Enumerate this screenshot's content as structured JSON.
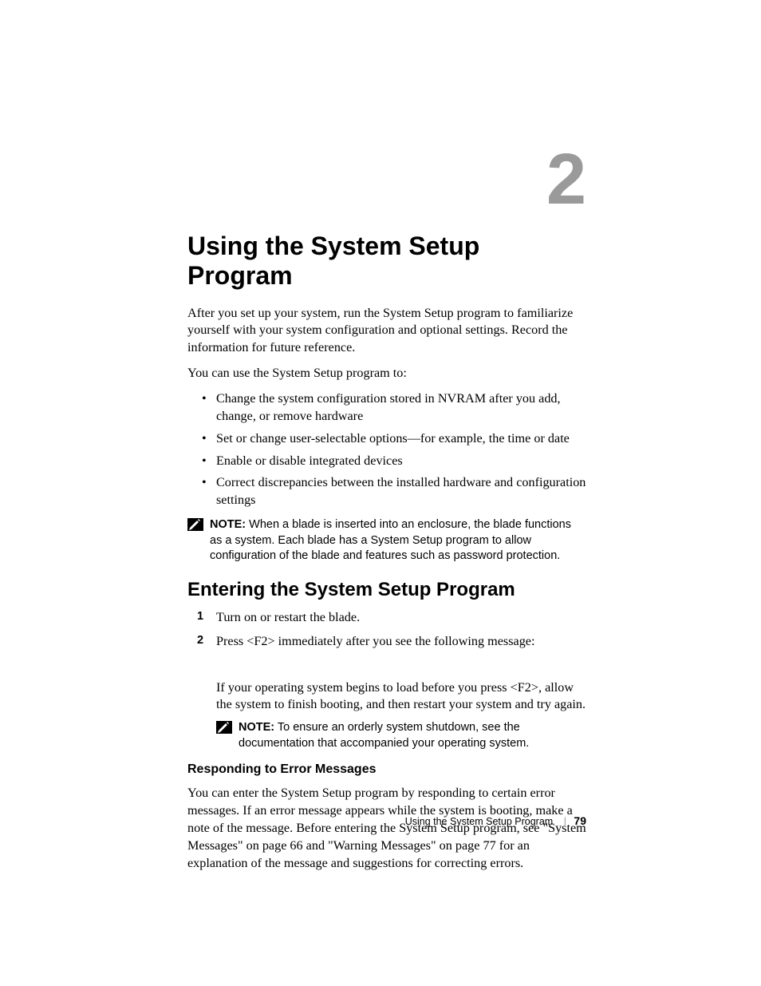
{
  "chapter": {
    "number": "2",
    "title": "Using the System Setup Program"
  },
  "intro": {
    "p1": "After you set up your system, run the System Setup program to familiarize yourself with your system configuration and optional settings. Record the information for future reference.",
    "p2": "You can use the System Setup program to:",
    "bullets": [
      "Change the system configuration stored in NVRAM after you add, change, or remove hardware",
      "Set or change user-selectable options—for example, the time or date",
      "Enable or disable integrated devices",
      "Correct discrepancies between the installed hardware and configuration settings"
    ]
  },
  "note1": {
    "label": "NOTE:",
    "text": " When a blade is inserted into an enclosure, the blade functions as a system. Each blade has a System Setup program to allow configuration of the blade and features such as password protection."
  },
  "section1": {
    "title": "Entering the System Setup Program",
    "steps": [
      "Turn on or restart the blade.",
      "Press <F2> immediately after you see the following message:"
    ],
    "step2_sub": "If your operating system begins to load before you press <F2>, allow the system to finish booting, and then restart your system and try again."
  },
  "note2": {
    "label": "NOTE:",
    "text": " To ensure an orderly system shutdown, see the documentation that accompanied your operating system."
  },
  "subsection1": {
    "title": "Responding to Error Messages",
    "p1": "You can enter the System Setup program by responding to certain error messages. If an error message appears while the system is booting, make a note of the message. Before entering the System Setup program, see \"System Messages\" on page 66 and \"Warning Messages\" on page 77 for an explanation of the message and suggestions for correcting errors."
  },
  "footer": {
    "title": "Using the System Setup Program",
    "page": "79"
  }
}
